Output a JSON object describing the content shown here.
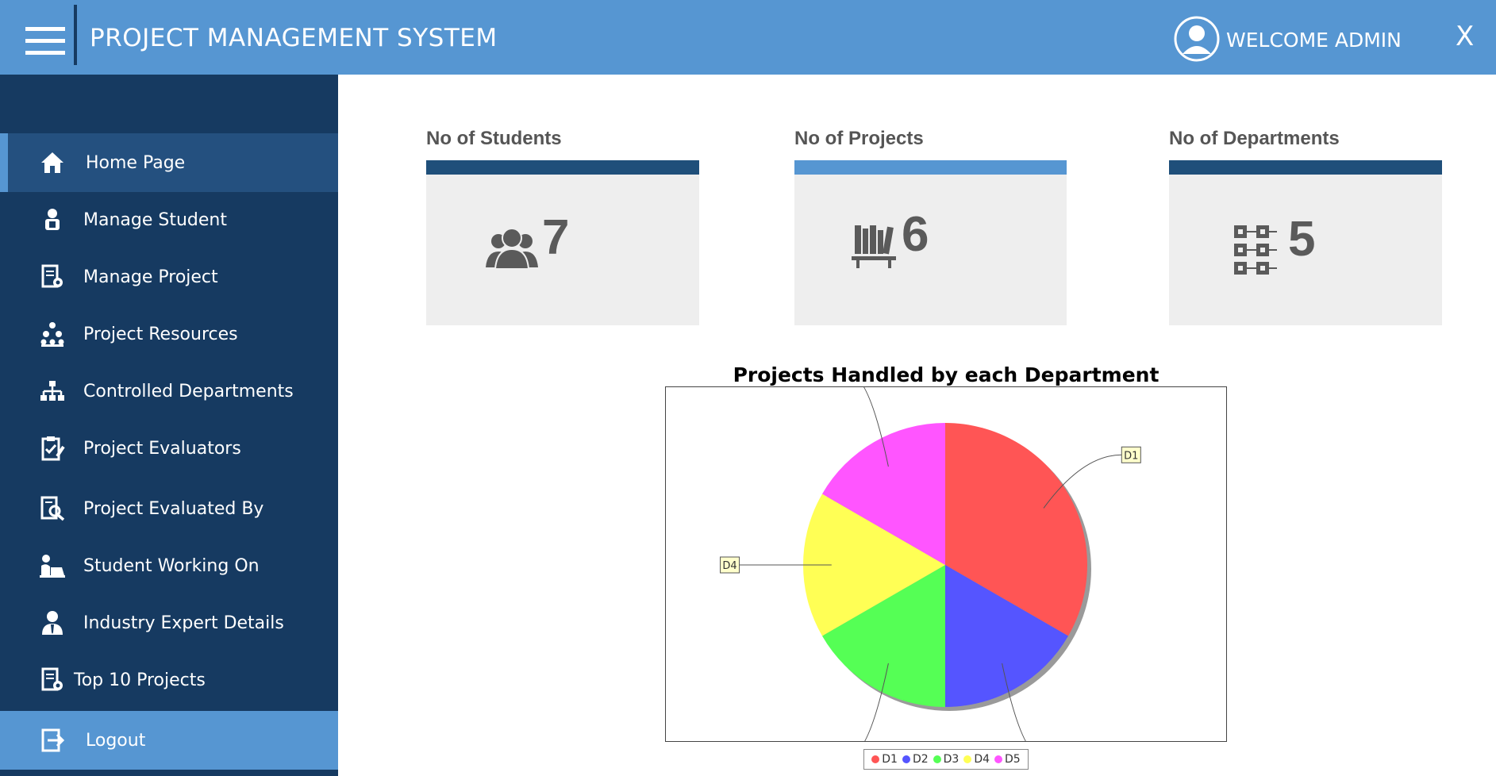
{
  "header": {
    "title": "PROJECT MANAGEMENT SYSTEM",
    "welcome": "WELCOME ADMIN",
    "close_label": "X"
  },
  "sidebar": {
    "items": [
      {
        "label": "Home Page",
        "icon": "home-icon",
        "active": true
      },
      {
        "label": "Manage Student",
        "icon": "student-icon"
      },
      {
        "label": "Manage Project",
        "icon": "project-settings-icon"
      },
      {
        "label": "Project Resources",
        "icon": "team-hierarchy-icon"
      },
      {
        "label": "Controlled Departments",
        "icon": "org-chart-icon"
      },
      {
        "label": "Project Evaluators",
        "icon": "clipboard-check-icon"
      },
      {
        "label": "Project Evaluated By",
        "icon": "document-search-icon"
      },
      {
        "label": "Student Working On",
        "icon": "person-laptop-icon"
      },
      {
        "label": "Industry Expert Details",
        "icon": "businessman-icon"
      },
      {
        "label": "Top 10 Projects",
        "icon": "document-settings-icon"
      }
    ],
    "logout": {
      "label": "Logout",
      "icon": "logout-icon"
    }
  },
  "stats": [
    {
      "title": "No of Students",
      "value": "7",
      "icon": "users-icon",
      "bar_color": "#1f4f7a"
    },
    {
      "title": "No of Projects",
      "value": "6",
      "icon": "bookshelf-icon",
      "bar_color": "#5696d2"
    },
    {
      "title": "No of Departments",
      "value": "5",
      "icon": "department-grid-icon",
      "bar_color": "#1f4f7a"
    }
  ],
  "chart_data": {
    "type": "pie",
    "title": "Projects Handled by each Department",
    "categories": [
      "D1",
      "D2",
      "D3",
      "D4",
      "D5"
    ],
    "values": [
      2,
      1,
      1,
      1,
      1
    ],
    "colors": [
      "#ff5555",
      "#5555ff",
      "#55ff55",
      "#ffff55",
      "#ff55ff"
    ],
    "legend": "bottom"
  }
}
